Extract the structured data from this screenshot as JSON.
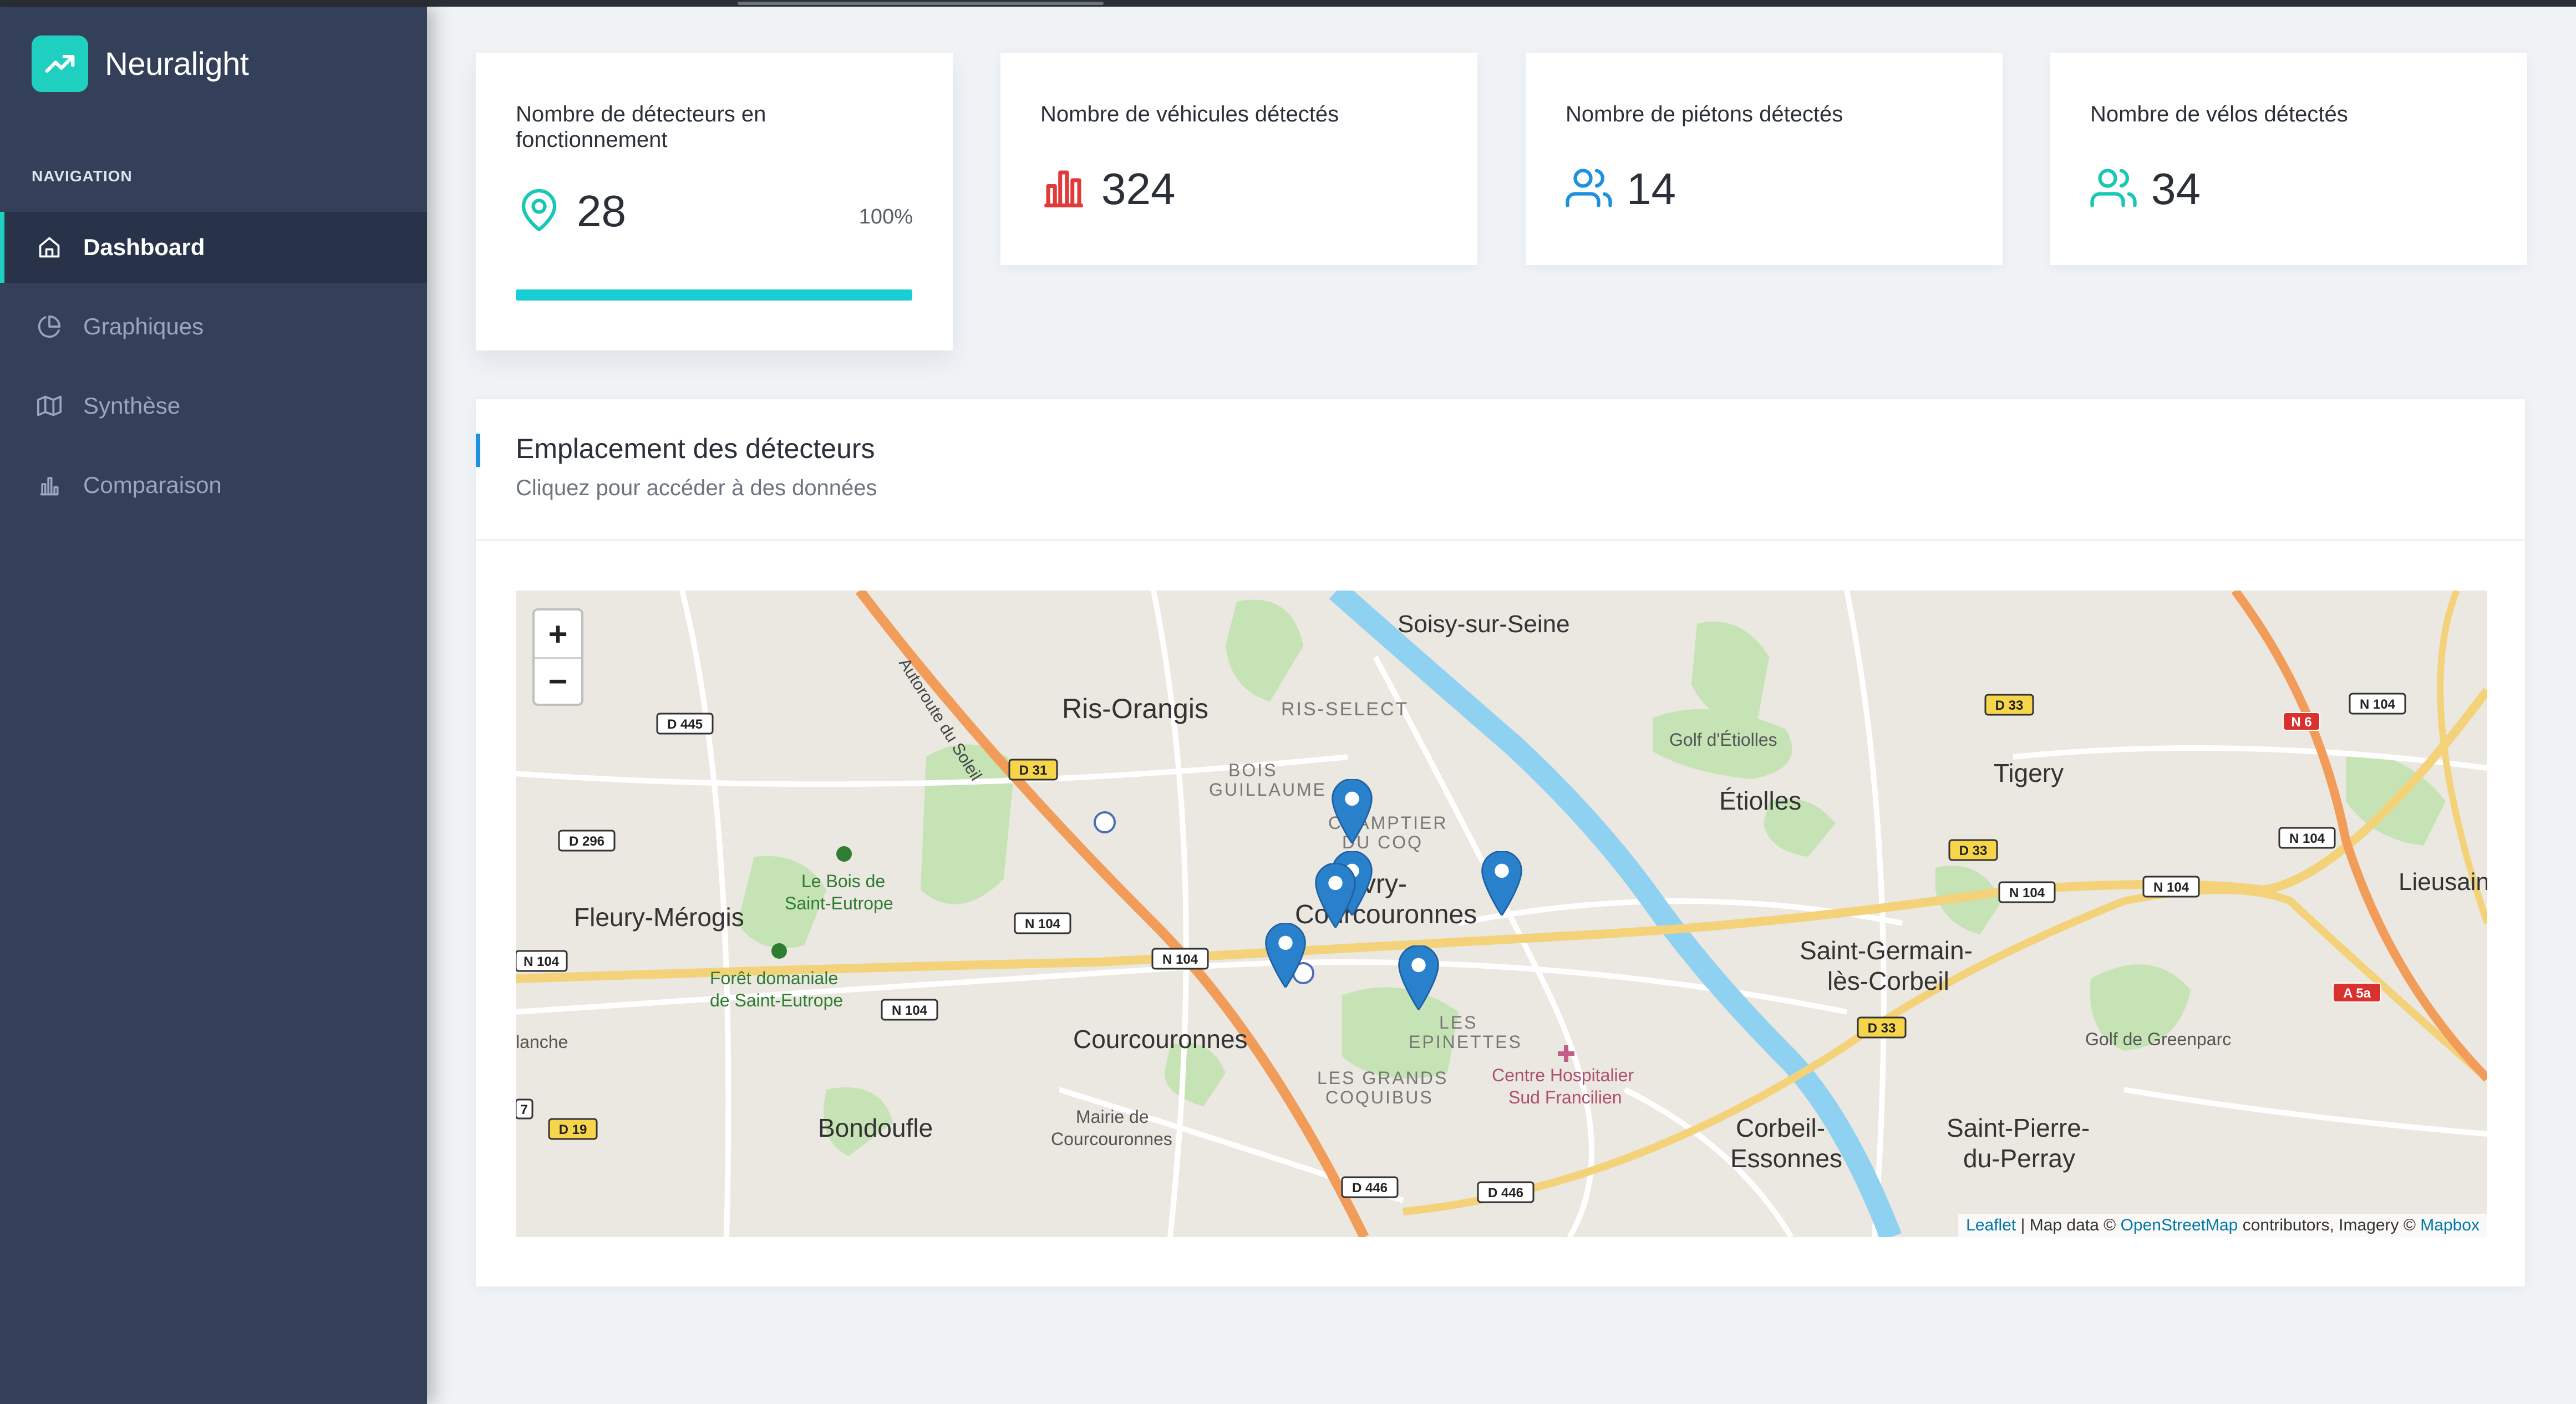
{
  "brand": {
    "name": "Neuralight",
    "accent": "#1fd0c0"
  },
  "sidebar": {
    "heading": "NAVIGATION",
    "items": [
      {
        "label": "Dashboard",
        "icon": "home-icon",
        "active": true
      },
      {
        "label": "Graphiques",
        "icon": "pie-chart-icon",
        "active": false
      },
      {
        "label": "Synthèse",
        "icon": "map-icon",
        "active": false
      },
      {
        "label": "Comparaison",
        "icon": "bar-chart-icon",
        "active": false
      }
    ]
  },
  "stats": [
    {
      "title": "Nombre de détecteurs en fonctionnement",
      "value": "28",
      "percent": "100%",
      "progress": 1.0,
      "icon": "map-pin-icon",
      "icon_color": "#19c8b4"
    },
    {
      "title": "Nombre de véhicules détectés",
      "value": "324",
      "icon": "bar-chart-icon",
      "icon_color": "#e03a3a"
    },
    {
      "title": "Nombre de piétons détectés",
      "value": "14",
      "icon": "users-icon",
      "icon_color": "#1e90e0"
    },
    {
      "title": "Nombre de vélos détectés",
      "value": "34",
      "icon": "users-icon",
      "icon_color": "#19c8b4"
    }
  ],
  "map_card": {
    "title": "Emplacement des détecteurs",
    "subtitle": "Cliquez pour accéder à des données",
    "zoom_in": "+",
    "zoom_out": "−",
    "attribution": {
      "leaflet": "Leaflet",
      "sep": " | Map data © ",
      "osm": "OpenStreetMap",
      "mid": " contributors, Imagery © ",
      "mapbox": "Mapbox"
    },
    "labels": {
      "soisy": "Soisy-sur-Seine",
      "ris_select": "RIS-SELECT",
      "ris_orangis": "Ris-Orangis",
      "bois_guillaume_1": "BOIS",
      "bois_guillaume_2": "GUILLAUME",
      "champtier_1": "CHAMPTIER",
      "champtier_2": "DU COQ",
      "evry_1": "Évry-",
      "evry_2": "Courcouronnes",
      "golf_etiolles": "Golf d'Étiolles",
      "etiolles": "Étiolles",
      "tigery": "Tigery",
      "lieusaint": "Lieusain",
      "fleury": "Fleury-Mérogis",
      "bois_st_eutrope_1": "Le Bois de",
      "bois_st_eutrope_2": "Saint-Eutrope",
      "foret_1": "Forêt domaniale",
      "foret_2": "de Saint-Eutrope",
      "courcouronnes": "Courcouronnes",
      "les_epinettes_1": "LES",
      "les_epinettes_2": "EPINETTES",
      "hopital_1": "Centre Hospitalier",
      "hopital_2": "Sud Francilien",
      "grands_coquibus_1": "LES GRANDS",
      "grands_coquibus_2": "COQUIBUS",
      "mairie_1": "Mairie de",
      "mairie_2": "Courcouronnes",
      "bondoufle": "Bondoufle",
      "st_germain_1": "Saint-Germain-",
      "st_germain_2": "lès-Corbeil",
      "golf_greenparc": "Golf de Greenparc",
      "corbeil_1": "Corbeil-",
      "corbeil_2": "Essonnes",
      "st_pierre_1": "Saint-Pierre-",
      "st_pierre_2": "du-Perray",
      "planche": "lanche",
      "autoroute": "Autoroute du Soleil"
    },
    "road_signs": {
      "d445": "D 445",
      "d31": "D 31",
      "d296": "D 296",
      "n104a": "N 104",
      "n104b": "N 104",
      "n104c": "N 104",
      "n104d": "N 104",
      "d19": "D 19",
      "d446a": "D 446",
      "d446b": "D 446",
      "d33a": "D 33",
      "d33b": "D 33",
      "d33c": "D 33",
      "n104e": "N 104",
      "n104f": "N 104",
      "n104g": "N 104",
      "n104h": "N 104",
      "n6": "N 6",
      "a5a": "A 5a",
      "n7": "7"
    }
  }
}
